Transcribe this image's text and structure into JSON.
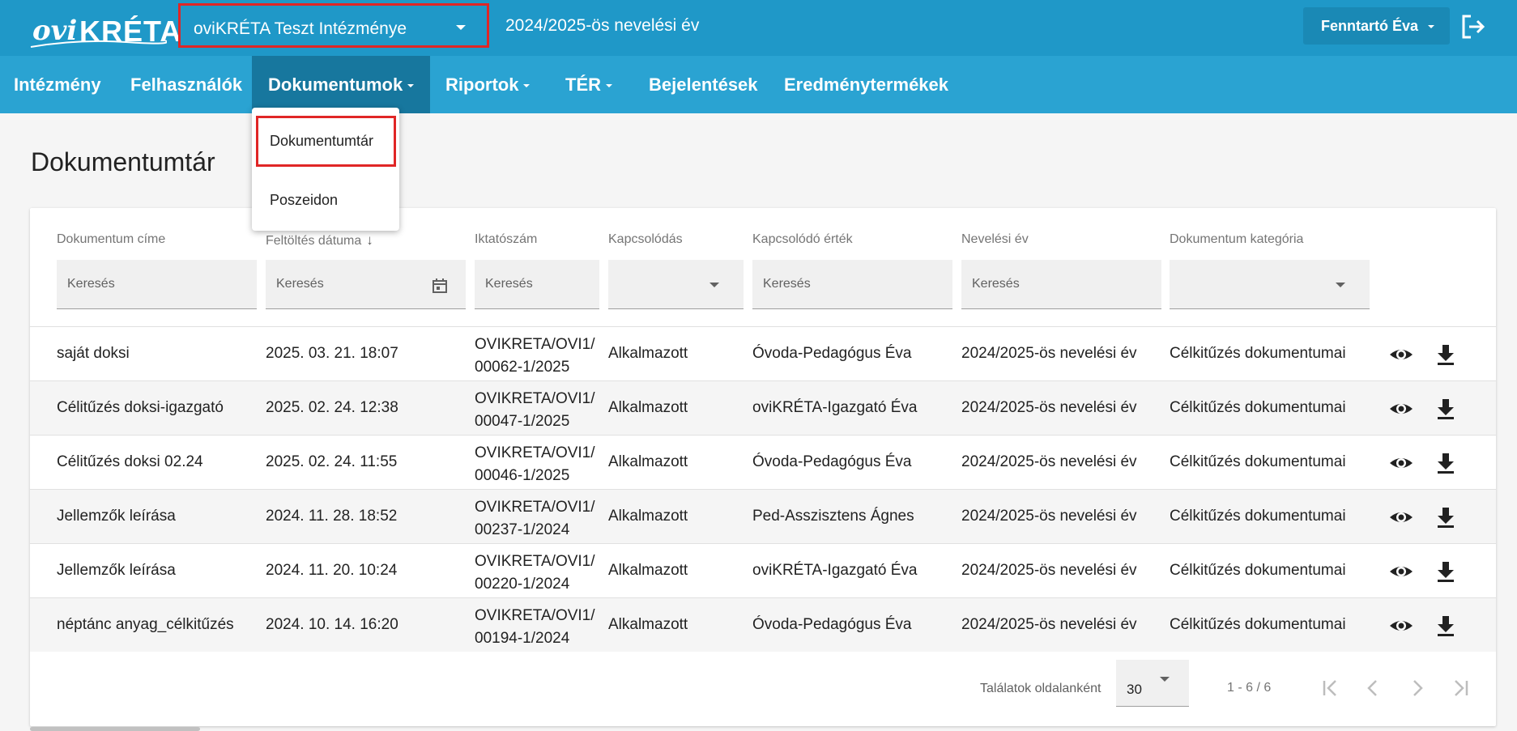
{
  "app": {
    "logo_text_ovi": "ovi",
    "logo_text_kreta": "KRÉTA",
    "institution": "oviKRÉTA Teszt Intézménye",
    "school_year": "2024/2025-ös nevelési év",
    "user_name": "Fenntartó Éva",
    "colors": {
      "topbar": "#1f98c8",
      "navbar": "#2aa3d2",
      "nav_active": "#17779e",
      "highlight": "#e02626"
    }
  },
  "nav": {
    "items": [
      {
        "label": "Intézmény"
      },
      {
        "label": "Felhasználók"
      },
      {
        "label": "Dokumentumok"
      },
      {
        "label": "Riportok"
      },
      {
        "label": "TÉR"
      },
      {
        "label": "Bejelentések"
      },
      {
        "label": "Eredménytermékek"
      }
    ],
    "active": "Dokumentumok"
  },
  "dropdown": {
    "items": [
      {
        "label": "Dokumentumtár",
        "selected": true
      },
      {
        "label": "Poszeidon"
      }
    ]
  },
  "page": {
    "title": "Dokumentumtár"
  },
  "table": {
    "columns": [
      {
        "label": "Dokumentum címe",
        "filter": "Keresés",
        "filter_type": "text"
      },
      {
        "label": "Feltöltés dátuma",
        "filter": "Keresés",
        "filter_type": "date",
        "sort": "desc"
      },
      {
        "label": "Iktatószám",
        "filter": "Keresés",
        "filter_type": "text"
      },
      {
        "label": "Kapcsolódás",
        "filter": "",
        "filter_type": "select"
      },
      {
        "label": "Kapcsolódó érték",
        "filter": "Keresés",
        "filter_type": "text"
      },
      {
        "label": "Nevelési év",
        "filter": "Keresés",
        "filter_type": "text"
      },
      {
        "label": "Dokumentum kategória",
        "filter": "",
        "filter_type": "select"
      }
    ],
    "rows": [
      {
        "title": "saját doksi",
        "date": "2025. 03. 21. 18:07",
        "reg1": "OVIKRETA/OVI1/",
        "reg2": "00062-1/2025",
        "link": "Alkalmazott",
        "value": "Óvoda-Pedagógus Éva",
        "year": "2024/2025-ös nevelési év",
        "category": "Célkitűzés dokumentumai"
      },
      {
        "title": "Célitűzés doksi-igazgató",
        "date": "2025. 02. 24. 12:38",
        "reg1": "OVIKRETA/OVI1/",
        "reg2": "00047-1/2025",
        "link": "Alkalmazott",
        "value": "oviKRÉTA-Igazgató Éva",
        "year": "2024/2025-ös nevelési év",
        "category": "Célkitűzés dokumentumai"
      },
      {
        "title": "Célitűzés doksi 02.24",
        "date": "2025. 02. 24. 11:55",
        "reg1": "OVIKRETA/OVI1/",
        "reg2": "00046-1/2025",
        "link": "Alkalmazott",
        "value": "Óvoda-Pedagógus Éva",
        "year": "2024/2025-ös nevelési év",
        "category": "Célkitűzés dokumentumai"
      },
      {
        "title": "Jellemzők leírása",
        "date": "2024. 11. 28. 18:52",
        "reg1": "OVIKRETA/OVI1/",
        "reg2": "00237-1/2024",
        "link": "Alkalmazott",
        "value": "Ped-Asszisztens Ágnes",
        "year": "2024/2025-ös nevelési év",
        "category": "Célkitűzés dokumentumai"
      },
      {
        "title": "Jellemzők leírása",
        "date": "2024. 11. 20. 10:24",
        "reg1": "OVIKRETA/OVI1/",
        "reg2": "00220-1/2024",
        "link": "Alkalmazott",
        "value": "oviKRÉTA-Igazgató Éva",
        "year": "2024/2025-ös nevelési év",
        "category": "Célkitűzés dokumentumai"
      },
      {
        "title": "néptánc anyag_célkitűzés",
        "date": "2024. 10. 14. 16:20",
        "reg1": "OVIKRETA/OVI1/",
        "reg2": "00194-1/2024",
        "link": "Alkalmazott",
        "value": "Óvoda-Pedagógus Éva",
        "year": "2024/2025-ös nevelési év",
        "category": "Célkitűzés dokumentumai"
      }
    ],
    "row_actions": [
      "eye-icon",
      "download-icon"
    ]
  },
  "pager": {
    "label": "Találatok oldalanként",
    "page_size": "30",
    "range": "1 - 6 / 6",
    "icons": [
      "first-page-icon",
      "prev-page-icon",
      "next-page-icon",
      "last-page-icon"
    ]
  }
}
